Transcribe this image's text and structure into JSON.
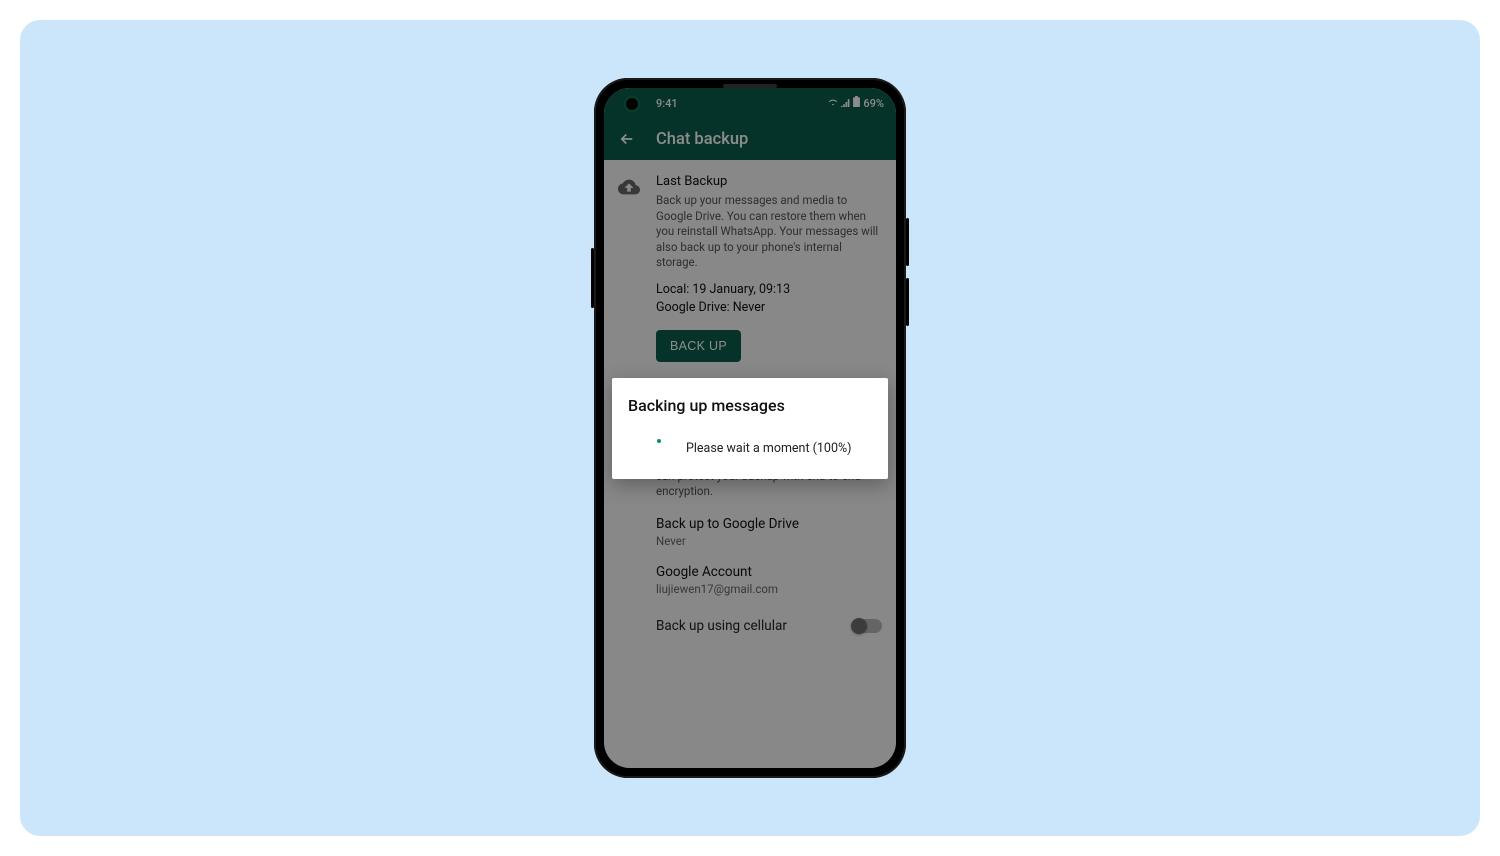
{
  "status": {
    "time": "9:41",
    "battery": "69%"
  },
  "appbar": {
    "title": "Chat backup"
  },
  "last_backup": {
    "title": "Last Backup",
    "desc": "Back up your messages and media to Google Drive. You can restore them when you reinstall WhatsApp. Your messages will also back up to your phone's internal storage.",
    "local": "Local: 19 January, 09:13",
    "drive": "Google Drive: Never",
    "button": "BACK UP"
  },
  "gdrive": {
    "desc": "Back up your chat history and media to Google Drive so if you change phones, your chat history is safe. For added security, you can protect your backup with end-to-end encryption.",
    "freq_label": "Back up to Google Drive",
    "freq_value": "Never",
    "account_label": "Google Account",
    "account_value": "liujiewen17@gmail.com",
    "cellular_label": "Back up using cellular"
  },
  "dialog": {
    "title": "Backing up messages",
    "message": "Please wait a moment (100%)"
  }
}
